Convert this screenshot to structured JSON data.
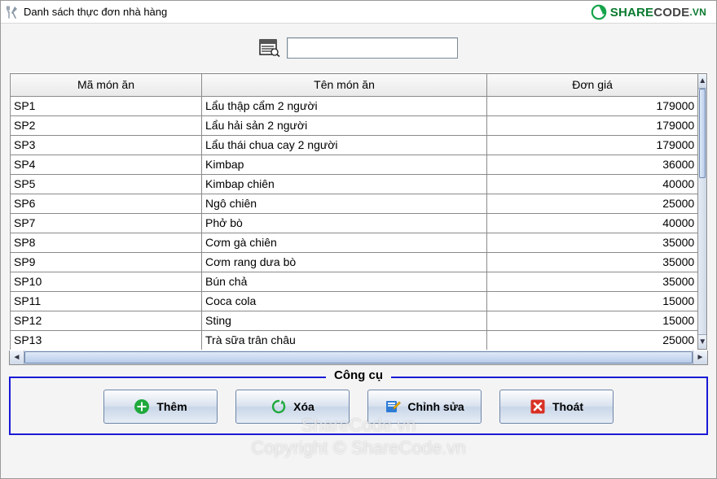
{
  "window": {
    "title": "Danh sách thực đơn nhà hàng"
  },
  "watermark": {
    "brand_share": "SHARE",
    "brand_code": "CODE",
    "brand_vn": ".VN",
    "line1": "ShareCode.vn",
    "line2": "Copyright © ShareCode.vn"
  },
  "search": {
    "value": "",
    "placeholder": ""
  },
  "table": {
    "headers": {
      "code": "Mã món ăn",
      "name": "Tên món ăn",
      "price": "Đơn giá"
    },
    "rows": [
      {
        "code": "SP1",
        "name": "Lẩu thập cẩm 2 người",
        "price": "179000"
      },
      {
        "code": "SP2",
        "name": "Lẩu hải sản 2 người",
        "price": "179000"
      },
      {
        "code": "SP3",
        "name": "Lẩu thái chua cay 2 người",
        "price": "179000"
      },
      {
        "code": "SP4",
        "name": "Kimbap",
        "price": "36000"
      },
      {
        "code": "SP5",
        "name": "Kimbap chiên",
        "price": "40000"
      },
      {
        "code": "SP6",
        "name": "Ngô chiên",
        "price": "25000"
      },
      {
        "code": "SP7",
        "name": "Phở bò",
        "price": "40000"
      },
      {
        "code": "SP8",
        "name": "Cơm gà chiên",
        "price": "35000"
      },
      {
        "code": "SP9",
        "name": "Cơm rang dưa bò",
        "price": "35000"
      },
      {
        "code": "SP10",
        "name": "Bún chả",
        "price": "35000"
      },
      {
        "code": "SP11",
        "name": "Coca cola",
        "price": "15000"
      },
      {
        "code": "SP12",
        "name": "Sting",
        "price": "15000"
      },
      {
        "code": "SP13",
        "name": "Trà sữa trân châu",
        "price": "25000"
      }
    ]
  },
  "tools": {
    "legend": "Công cụ",
    "add_label": "Thêm",
    "delete_label": "Xóa",
    "edit_label": "Chỉnh sửa",
    "exit_label": "Thoát"
  }
}
